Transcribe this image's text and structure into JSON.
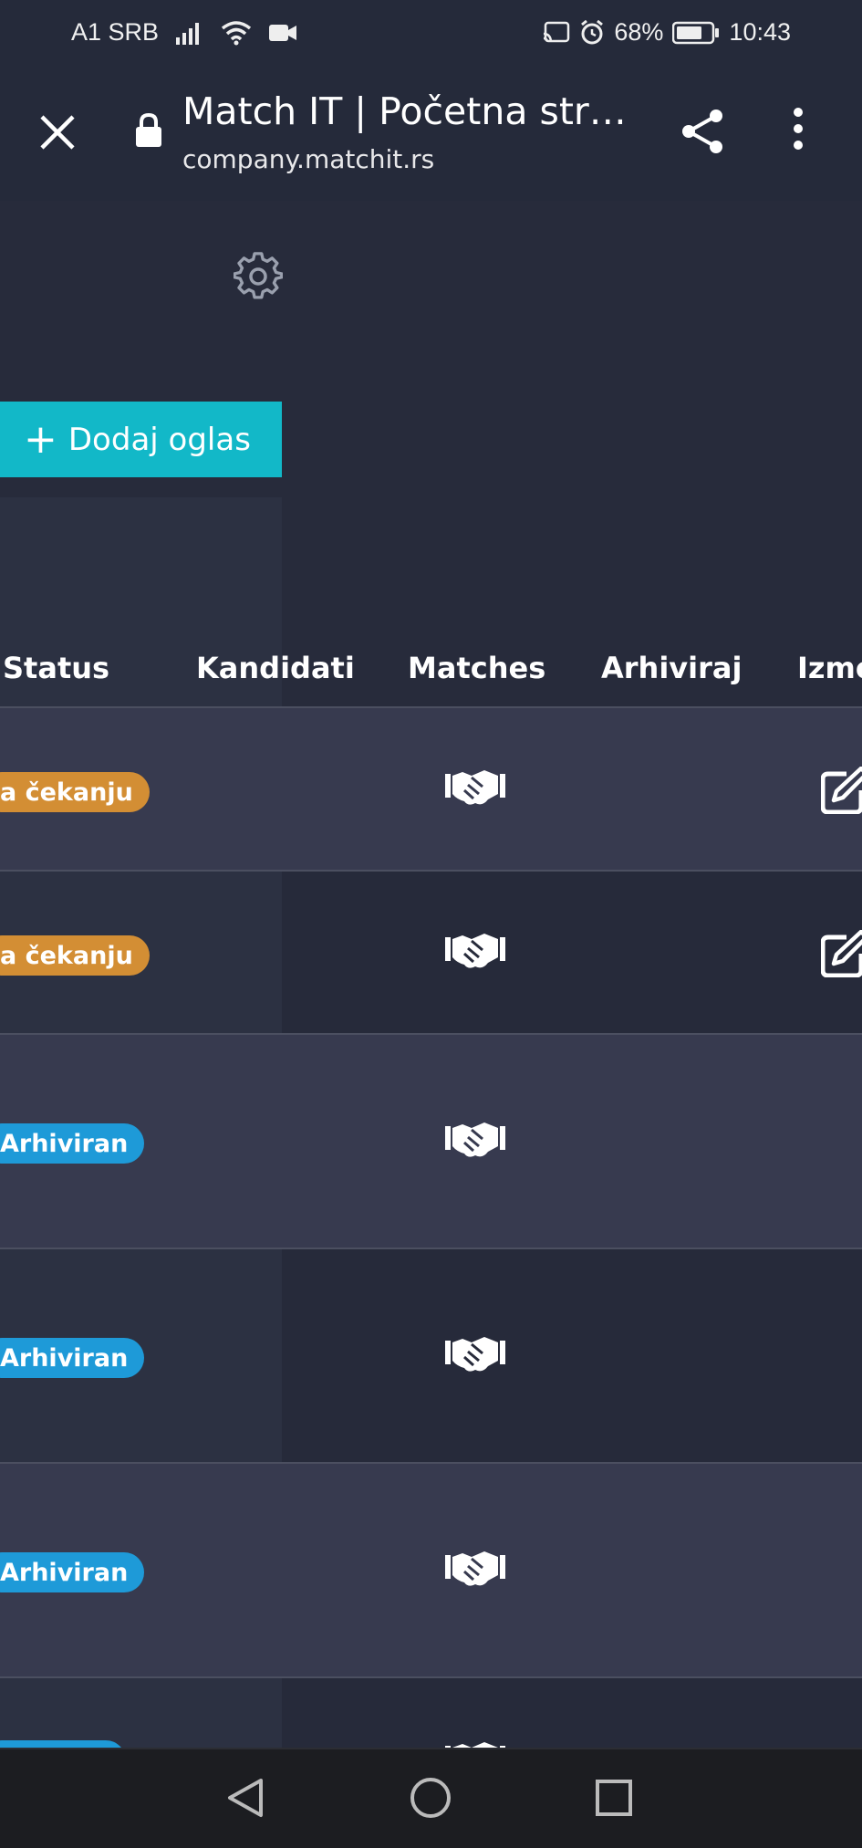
{
  "status_bar": {
    "carrier": "A1 SRB",
    "battery": "68%",
    "time": "10:43",
    "icons": [
      "signal-icon",
      "wifi-icon",
      "video-call-icon",
      "cast-icon",
      "alarm-icon",
      "battery-icon"
    ]
  },
  "browser": {
    "title": "Match IT | Početna stra…",
    "url": "company.matchit.rs",
    "icons": [
      "close-icon",
      "lock-icon",
      "share-icon",
      "more-vertical-icon"
    ]
  },
  "page": {
    "settings_icon": "gear-icon",
    "add_button": {
      "plus": "+",
      "label": "Dodaj oglas"
    },
    "table": {
      "headers": [
        "Status",
        "Kandidati",
        "Matches",
        "Arhiviraj",
        "Izme"
      ],
      "rows": [
        {
          "status": "a čekanju",
          "status_type": "pending",
          "matches_icon": "handshake-icon",
          "edit_icon": "edit-icon"
        },
        {
          "status": "a čekanju",
          "status_type": "pending",
          "matches_icon": "handshake-icon",
          "edit_icon": "edit-icon"
        },
        {
          "status": "Arhiviran",
          "status_type": "archived",
          "matches_icon": "handshake-icon"
        },
        {
          "status": "Arhiviran",
          "status_type": "archived",
          "matches_icon": "handshake-icon"
        },
        {
          "status": "Arhiviran",
          "status_type": "archived",
          "matches_icon": "handshake-icon"
        },
        {
          "status": "",
          "status_type": "archived",
          "matches_icon": "handshake-icon"
        }
      ]
    }
  },
  "colors": {
    "background": "#272b3b",
    "accent_button": "#12b8c8",
    "pending_badge": "#d38e34",
    "archived_badge": "#1e9ad8"
  },
  "nav_bar": {
    "icons": [
      "back-icon",
      "home-icon",
      "recents-icon"
    ]
  }
}
